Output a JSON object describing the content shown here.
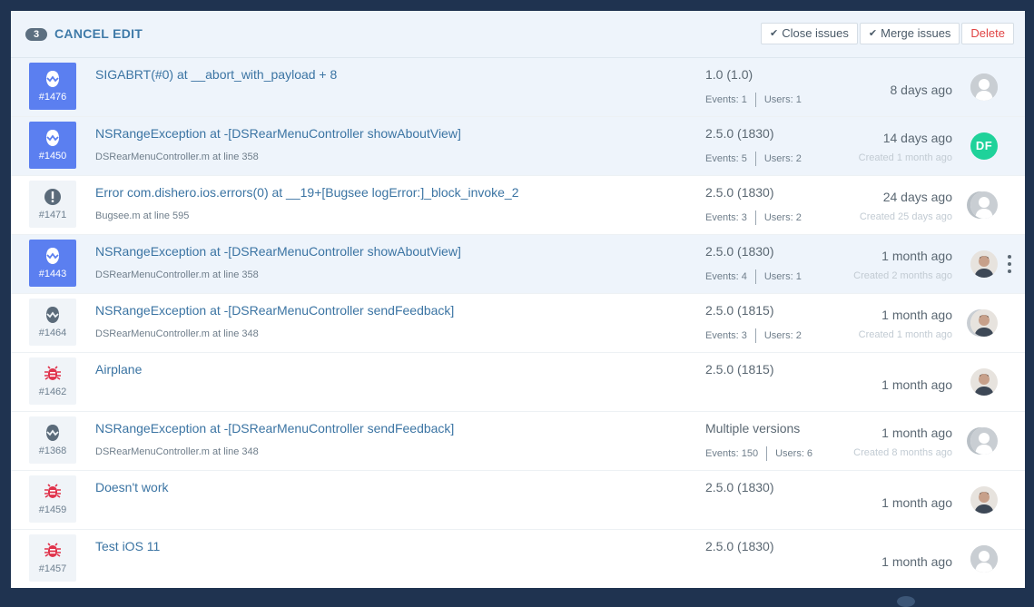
{
  "header": {
    "count": "3",
    "cancel_label": "CANCEL EDIT",
    "close_label": "Close issues",
    "merge_label": "Merge issues",
    "delete_label": "Delete"
  },
  "colors": {
    "accent": "#3b74a3",
    "selected_bg": "#eef4fb",
    "crash_blue": "#5b7ff0",
    "bug_red": "#e0334c",
    "danger": "#e04343"
  },
  "issues": [
    {
      "number": "#1476",
      "type": "crash-icon",
      "title": "SIGABRT(#0) at __abort_with_payload + 8",
      "subtitle": "",
      "version": "1.0 (1.0)",
      "events": "Events: 1",
      "users": "Users: 1",
      "ago": "8 days ago",
      "created": "",
      "avatar": "default-avatar",
      "selected": true
    },
    {
      "number": "#1450",
      "type": "crash-icon",
      "title": "NSRangeException at -[DSRearMenuController showAboutView]",
      "subtitle": "DSRearMenuController.m at line 358",
      "version": "2.5.0 (1830)",
      "events": "Events: 5",
      "users": "Users: 2",
      "ago": "14 days ago",
      "created": "Created 1 month ago",
      "avatar": "DF",
      "selected": true
    },
    {
      "number": "#1471",
      "type": "error-icon",
      "title": "Error com.dishero.ios.errors(0) at __19+[Bugsee logError:]_block_invoke_2",
      "subtitle": "Bugsee.m at line 595",
      "version": "2.5.0 (1830)",
      "events": "Events: 3",
      "users": "Users: 2",
      "ago": "24 days ago",
      "created": "Created 25 days ago",
      "avatar": "stacked-avatar",
      "selected": false
    },
    {
      "number": "#1443",
      "type": "crash-icon",
      "title": "NSRangeException at -[DSRearMenuController showAboutView]",
      "subtitle": "DSRearMenuController.m at line 358",
      "version": "2.5.0 (1830)",
      "events": "Events: 4",
      "users": "Users: 1",
      "ago": "1 month ago",
      "created": "Created 2 months ago",
      "avatar": "person-avatar",
      "selected": true
    },
    {
      "number": "#1464",
      "type": "crash-icon",
      "title": "NSRangeException at -[DSRearMenuController sendFeedback]",
      "subtitle": "DSRearMenuController.m at line 348",
      "version": "2.5.0 (1815)",
      "events": "Events: 3",
      "users": "Users: 2",
      "ago": "1 month ago",
      "created": "Created 1 month ago",
      "avatar": "stacked-person-avatar",
      "selected": false
    },
    {
      "number": "#1462",
      "type": "bug-icon",
      "title": "Airplane",
      "subtitle": "",
      "version": "2.5.0 (1815)",
      "events": "",
      "users": "",
      "ago": "1 month ago",
      "created": "",
      "avatar": "person-avatar",
      "selected": false
    },
    {
      "number": "#1368",
      "type": "crash-icon",
      "title": "NSRangeException at -[DSRearMenuController sendFeedback]",
      "subtitle": "DSRearMenuController.m at line 348",
      "version": "Multiple versions",
      "events": "Events: 150",
      "users": "Users: 6",
      "ago": "1 month ago",
      "created": "Created 8 months ago",
      "avatar": "stacked-avatar",
      "selected": false
    },
    {
      "number": "#1459",
      "type": "bug-icon",
      "title": "Doesn't work",
      "subtitle": "",
      "version": "2.5.0 (1830)",
      "events": "",
      "users": "",
      "ago": "1 month ago",
      "created": "",
      "avatar": "person-avatar",
      "selected": false
    },
    {
      "number": "#1457",
      "type": "bug-icon",
      "title": "Test iOS 11",
      "subtitle": "",
      "version": "2.5.0 (1830)",
      "events": "",
      "users": "",
      "ago": "1 month ago",
      "created": "",
      "avatar": "default-avatar",
      "selected": false
    }
  ]
}
